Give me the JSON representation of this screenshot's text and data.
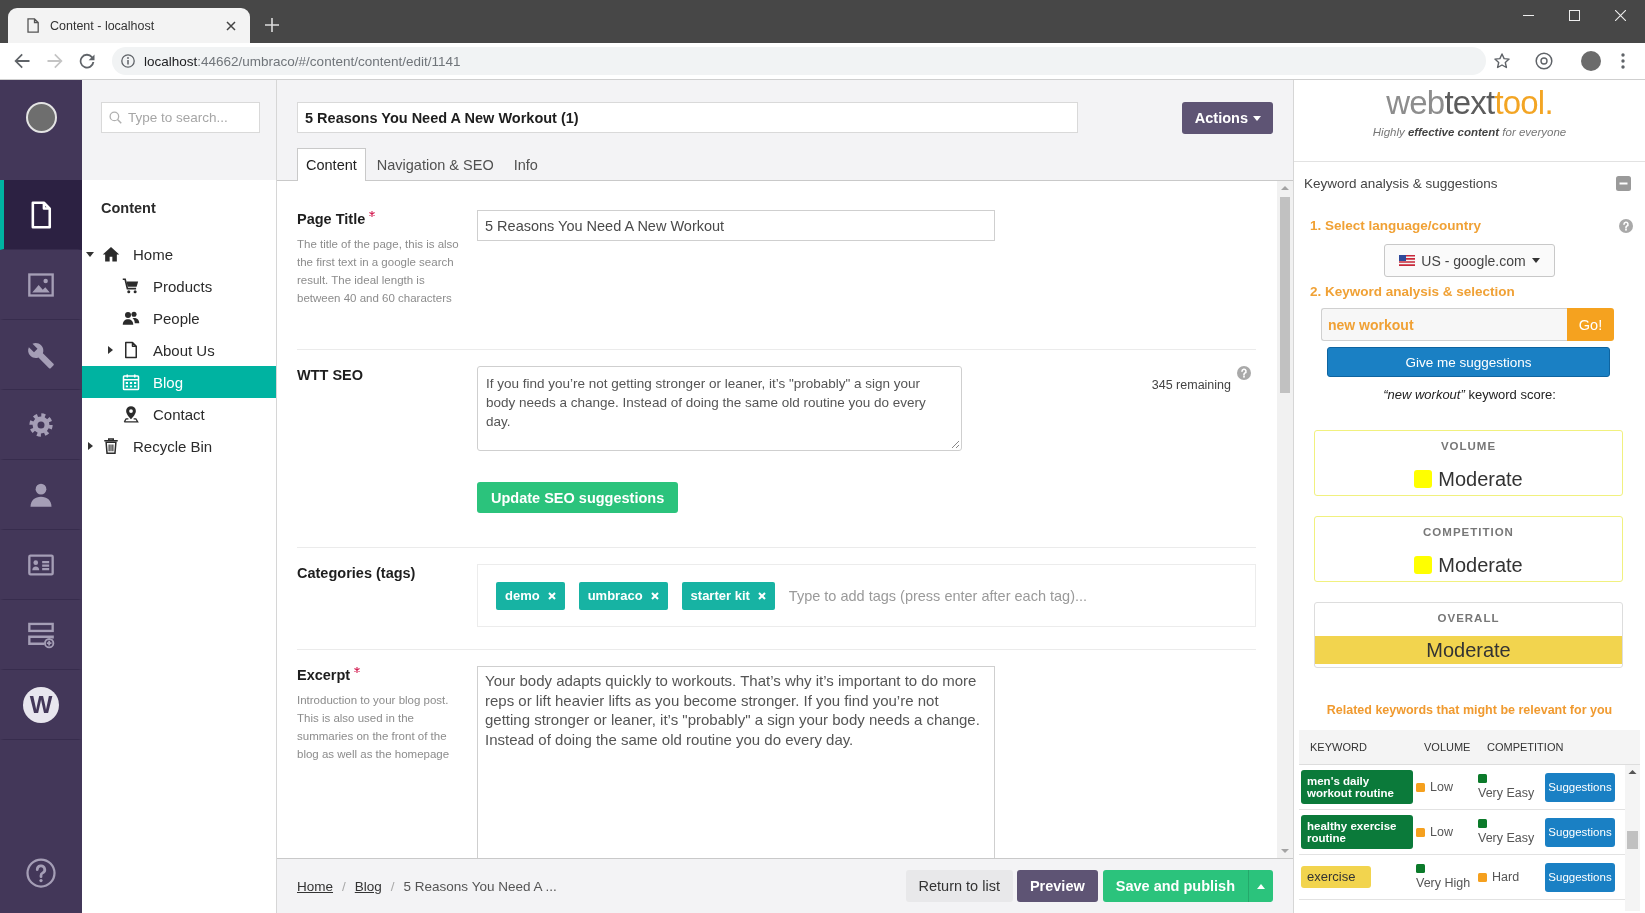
{
  "browser": {
    "tab_title": "Content - localhost",
    "url_host": "localhost",
    "url_path": ":44662/umbraco/#/content/content/edit/1141",
    "forward_disabled": true
  },
  "nav": {
    "items": [
      {
        "kind": "document",
        "selected": true
      },
      {
        "kind": "image",
        "selected": false
      },
      {
        "kind": "wrench",
        "selected": false
      },
      {
        "kind": "gear",
        "selected": false
      },
      {
        "kind": "person",
        "selected": false
      },
      {
        "kind": "card",
        "selected": false
      },
      {
        "kind": "form",
        "selected": false
      },
      {
        "kind": "logo",
        "text": "W",
        "selected": false
      }
    ]
  },
  "tree": {
    "search": {
      "placeholder": "Type to search..."
    },
    "heading": "Content",
    "items": [
      {
        "label": "Home",
        "kind": "home",
        "expanded": true,
        "selected": false,
        "children": [
          {
            "label": "Products",
            "kind": "cart",
            "selected": false
          },
          {
            "label": "People",
            "kind": "people",
            "selected": false
          },
          {
            "label": "About Us",
            "kind": "page",
            "expanded": false,
            "selected": false
          },
          {
            "label": "Blog",
            "kind": "calendar",
            "selected": true
          },
          {
            "label": "Contact",
            "kind": "pin",
            "selected": false
          }
        ]
      },
      {
        "label": "Recycle Bin",
        "kind": "bin",
        "expanded": false,
        "selected": false
      }
    ]
  },
  "editor": {
    "name": "5 Reasons You Need A New Workout (1)",
    "actions": "Actions",
    "tabs": [
      {
        "label": "Content",
        "selected": true
      },
      {
        "label": "Navigation & SEO",
        "selected": false
      },
      {
        "label": "Info",
        "selected": false
      }
    ],
    "fields": [
      {
        "kind": "text",
        "label": "Page Title",
        "required": true,
        "description": "The title of the page, this is also the first text in a google search result. The ideal length is between 40 and 60 characters",
        "value": "5 Reasons You Need A New Workout"
      },
      {
        "kind": "seo",
        "label": "WTT SEO",
        "required": false,
        "value": "If you find you’re not getting stronger or leaner, it’s \"probably\" a sign your body needs a change. Instead of doing the same old routine you do every day.",
        "counter": "345 remaining",
        "button": "Update SEO suggestions"
      },
      {
        "kind": "tags",
        "label": "Categories (tags)",
        "required": false,
        "tags": [
          "demo",
          "umbraco",
          "starter kit"
        ],
        "placeholder": "Type to add tags (press enter after each tag)..."
      },
      {
        "kind": "textarea",
        "label": "Excerpt",
        "required": true,
        "description": "Introduction to your blog post. This is also used in the summaries on the front of the blog as well as the homepage",
        "value": "Your body adapts quickly to workouts. That’s why it’s important to do more reps or lift heavier lifts as you become stronger. If you find you’re not getting stronger or leaner, it’s \"probably\" a sign your body needs a change. Instead of doing the same old routine you do every day."
      }
    ],
    "footer": {
      "breadcrumb": [
        {
          "label": "Home",
          "link": true
        },
        {
          "label": "Blog",
          "link": true
        },
        {
          "label": "5 Reasons You Need A ...",
          "link": false
        }
      ],
      "separators": [
        "/",
        "/"
      ],
      "buttons": [
        {
          "label": "Return to list",
          "kind": "plain"
        },
        {
          "label": "Preview",
          "kind": "secondary"
        },
        {
          "label": "Save and publish",
          "kind": "primary"
        }
      ]
    }
  },
  "wtt": {
    "logo": [
      "web",
      "text",
      "tool."
    ],
    "tagline": "Highly **effective content** for everyone",
    "panel_title": "Keyword analysis & suggestions",
    "expanded": true,
    "step1": "1. Select language/country",
    "region": "US - google.com",
    "step2": "2. Keyword analysis & selection",
    "keyword": "new workout",
    "go": "Go!",
    "suggest_button": "Give me suggestions",
    "score_caption": "*“new workout”* keyword score:",
    "scores": [
      {
        "kind": "swatch",
        "label": "VOLUME",
        "value": "Moderate",
        "color": "#ffff00"
      },
      {
        "kind": "swatch",
        "label": "COMPETITION",
        "value": "Moderate",
        "color": "#ffff00"
      },
      {
        "kind": "band",
        "label": "OVERALL",
        "value": "Moderate",
        "color": "#f2d44e"
      }
    ],
    "related_title": "Related keywords that might be relevant for you",
    "table": {
      "columns": [
        "KEYWORD",
        "VOLUME",
        "COMPETITION"
      ],
      "rows": [
        {
          "keyword": "men's daily workout routine",
          "color": "#0b7a3a",
          "volume": {
            "text": "Low",
            "color": "#f5a01e"
          },
          "competition": {
            "text": "Very Easy",
            "color": "#0b7a2a"
          },
          "button": "Suggestions"
        },
        {
          "keyword": "healthy exercise routine",
          "color": "#0b7a3a",
          "volume": {
            "text": "Low",
            "color": "#f5a01e"
          },
          "competition": {
            "text": "Very Easy",
            "color": "#0b7a2a"
          },
          "button": "Suggestions"
        },
        {
          "keyword": "exercise",
          "color": "#f2d44e",
          "volume": {
            "text": "Very High",
            "color": "#0b7a2a"
          },
          "competition": {
            "text": "Hard",
            "color": "#f5a01e"
          },
          "button": "Suggestions"
        }
      ]
    }
  }
}
